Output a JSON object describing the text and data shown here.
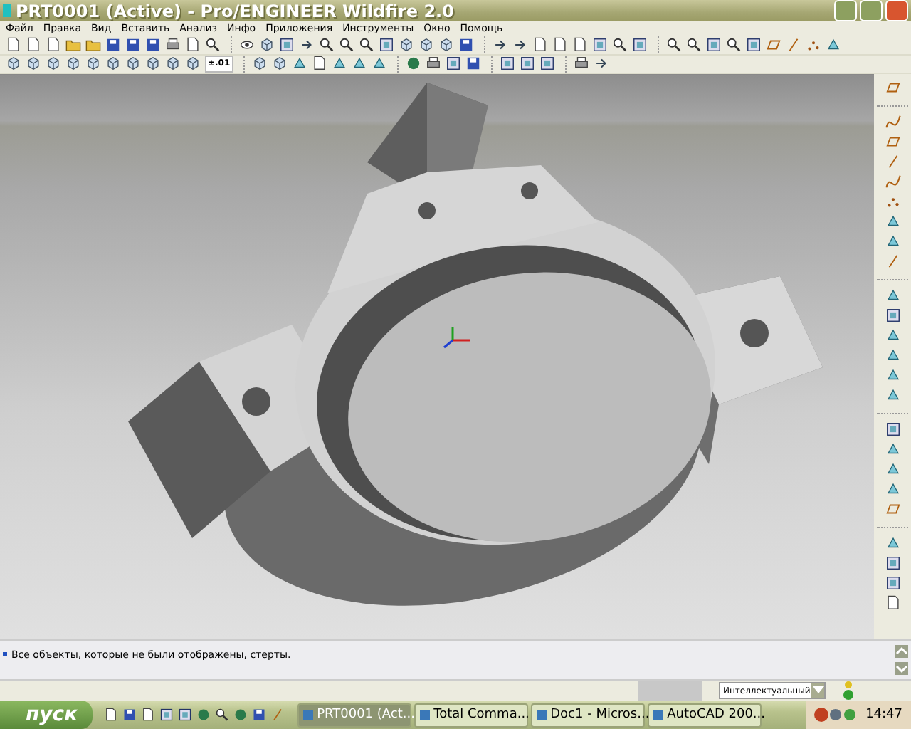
{
  "window": {
    "title": "PRT0001 (Active) - Pro/ENGINEER Wildfire 2.0"
  },
  "menu": [
    "Файл",
    "Правка",
    "Вид",
    "Вставить",
    "Анализ",
    "Инфо",
    "Приложения",
    "Инструменты",
    "Окно",
    "Помощь"
  ],
  "toolbar_value": {
    "label": "±.01"
  },
  "message_area": {
    "messages": [
      "Все объекты, которые не были отображены, стерты."
    ]
  },
  "status_bar": {
    "filter": "Интеллектуальный"
  },
  "taskbar": {
    "start": "пуск",
    "tasks": [
      {
        "label": "PRT0001 (Act...",
        "selected": true
      },
      {
        "label": "Total Comma...",
        "selected": false
      },
      {
        "label": "Doc1 - Micros...",
        "selected": false
      },
      {
        "label": "AutoCAD 200...",
        "selected": false
      }
    ],
    "clock": "14:47"
  }
}
